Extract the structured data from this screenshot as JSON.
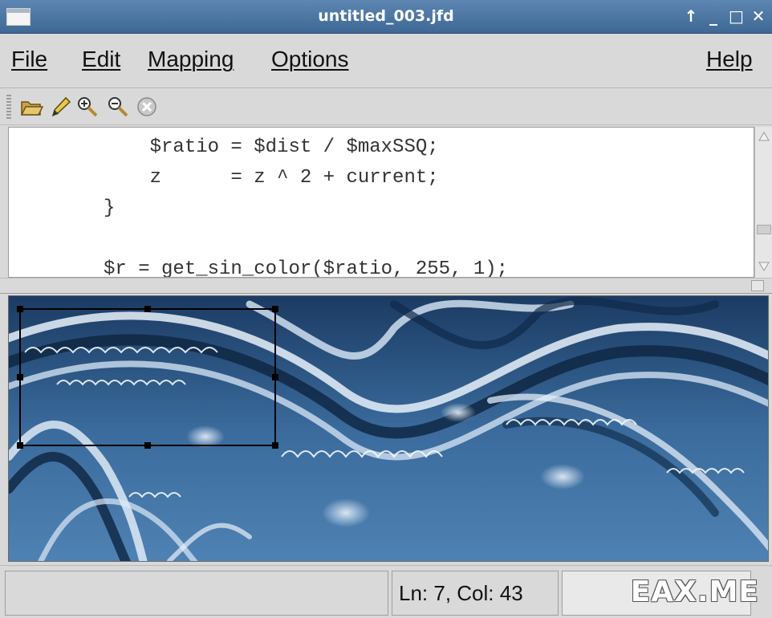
{
  "window": {
    "title": "untitled_003.jfd",
    "controls": {
      "pin": "↑",
      "minimize": "_",
      "maximize": "□",
      "close": "✕"
    }
  },
  "menu": {
    "file": {
      "key": "F",
      "rest": "ile"
    },
    "edit": {
      "key": "E",
      "rest": "dit"
    },
    "mapping": {
      "key": "M",
      "rest": "apping"
    },
    "options": {
      "key": "O",
      "rest": "ptions"
    },
    "help": {
      "key": "H",
      "rest": "elp"
    }
  },
  "toolbar": {
    "icons": [
      "open-folder-icon",
      "edit-pen-icon",
      "zoom-in-icon",
      "zoom-out-icon",
      "stop-icon"
    ]
  },
  "editor": {
    "lines": [
      "    $ratio = $dist / $maxSSQ;",
      "    z      = z ^ 2 + current;",
      "}",
      "",
      "$r = get_sin_color($ratio, 255, 1);"
    ]
  },
  "status": {
    "position": "Ln: 7, Col: 43",
    "watermark": "EAX.ME"
  },
  "colors": {
    "titlebar": "#4a74a3",
    "fractal_dark": "#0e2440",
    "fractal_mid": "#3a6b9c",
    "fractal_light": "#e8f1fa"
  }
}
